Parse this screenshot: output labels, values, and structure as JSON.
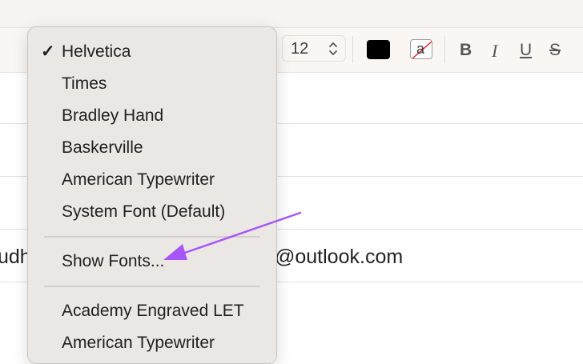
{
  "toolbar": {
    "font_size": "12",
    "text_color": "#000000",
    "background_color_letter": "a",
    "bold_label": "B",
    "italic_label": "I",
    "underline_label": "U",
    "strikethrough_label": "S"
  },
  "row": {
    "left_fragment": "udh",
    "right_fragment": "@outlook.com"
  },
  "font_menu": {
    "selected_mark": "✓",
    "items": [
      {
        "label": "Helvetica"
      },
      {
        "label": "Times"
      },
      {
        "label": "Bradley Hand"
      },
      {
        "label": "Baskerville"
      },
      {
        "label": "American Typewriter"
      },
      {
        "label": "System Font (Default)"
      }
    ],
    "show_fonts_label": "Show Fonts...",
    "more_items": [
      {
        "label": "Academy Engraved LET"
      },
      {
        "label": "American Typewriter"
      }
    ]
  },
  "colors": {
    "annotation_arrow": "#a855f7",
    "menu_background": "#ebe7e4"
  }
}
